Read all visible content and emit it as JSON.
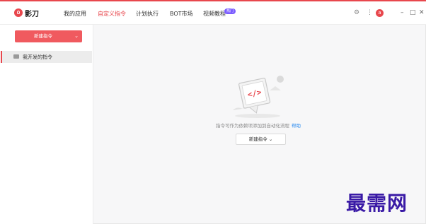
{
  "app": {
    "name": "影刀",
    "accent": "#e8474d"
  },
  "nav": [
    {
      "label": "我的应用"
    },
    {
      "label": "自定义指令"
    },
    {
      "label": "计划执行"
    },
    {
      "label": "BOT市场"
    },
    {
      "label": "视频教程",
      "badge": "热门"
    }
  ],
  "header": {
    "avatar_letter": "a",
    "icons": [
      "settings-icon",
      "more-icon"
    ],
    "window_controls": [
      "minimize-icon",
      "restore-icon",
      "close-icon"
    ]
  },
  "sidebar": {
    "new_button": "新建指令",
    "items": [
      {
        "label": "我开发的指令"
      }
    ]
  },
  "main": {
    "hint": "指令可作为依赖项添加到自动化流程",
    "help_link": "帮助",
    "new_button": "新建指令"
  },
  "watermark": "最需网"
}
